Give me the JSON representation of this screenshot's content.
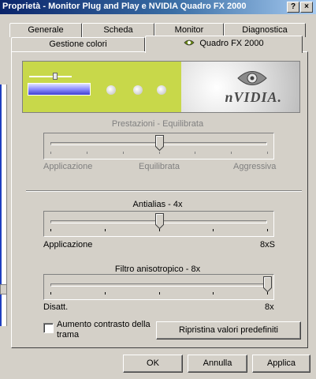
{
  "window": {
    "title": "Proprietà - Monitor Plug and Play e NVIDIA Quadro FX 2000",
    "help_button": "?",
    "close_button": "×"
  },
  "tabs_row1": [
    "Generale",
    "Scheda",
    "Monitor",
    "Diagnostica"
  ],
  "tabs_row2": [
    {
      "label": "Gestione colori",
      "active": false
    },
    {
      "label": "Quadro FX 2000",
      "active": true
    }
  ],
  "banner": {
    "logo_text": "nVIDIA."
  },
  "sliders": [
    {
      "id": "prestazioni",
      "title": "Prestazioni - Equilibrata",
      "enabled": false,
      "value_fraction": 0.5,
      "ticks": 7,
      "labels": [
        "Applicazione",
        "Equilibrata",
        "Aggressiva"
      ]
    },
    {
      "id": "antialias",
      "title": "Antialias - 4x",
      "enabled": true,
      "value_fraction": 0.5,
      "ticks": 5,
      "labels": [
        "Applicazione",
        "8xS"
      ]
    },
    {
      "id": "aniso",
      "title": "Filtro anisotropico - 8x",
      "enabled": true,
      "value_fraction": 1.0,
      "ticks": 5,
      "labels": [
        "Disatt.",
        "8x"
      ]
    }
  ],
  "checkbox": {
    "label_line1": "Aumento contrasto della",
    "label_line2": "trama",
    "checked": false
  },
  "restore_button": "Ripristina valori predefiniti",
  "dialog_buttons": {
    "ok": "OK",
    "cancel": "Annulla",
    "apply": "Applica"
  },
  "colors": {
    "titlebar_start": "#0a246a",
    "banner_green": "#c8d84a",
    "face": "#d4d0c8"
  }
}
